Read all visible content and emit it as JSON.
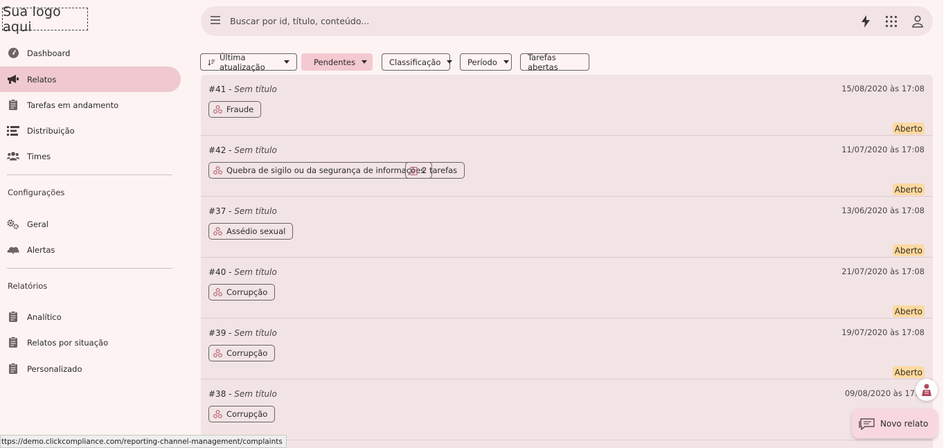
{
  "logo": {
    "text": "Sua logo aqui"
  },
  "sidebar": {
    "items": [
      {
        "label": "Dashboard",
        "icon": "dashboard-icon"
      },
      {
        "label": "Relatos",
        "icon": "megaphone-icon",
        "active": true
      },
      {
        "label": "Tarefas em andamento",
        "icon": "clipboard-icon"
      },
      {
        "label": "Distribuição",
        "icon": "distribution-icon"
      },
      {
        "label": "Times",
        "icon": "team-icon"
      }
    ],
    "config_heading": "Configurações",
    "config_items": [
      {
        "label": "Geral",
        "icon": "gears-icon"
      },
      {
        "label": "Alertas",
        "icon": "alerts-icon"
      }
    ],
    "reports_heading": "Relatórios",
    "report_items": [
      {
        "label": "Analítico",
        "icon": "clipboard-icon"
      },
      {
        "label": "Relatos por situação",
        "icon": "clipboard-icon"
      },
      {
        "label": "Personalizado",
        "icon": "clipboard-icon"
      }
    ]
  },
  "search": {
    "placeholder": "Buscar por id, título, conteúdo..."
  },
  "filters": {
    "sort": "Última atualização",
    "pending": "Pendentes",
    "classification": "Classificação",
    "period": "Período",
    "open_tasks": "Tarefas abertas"
  },
  "reports": [
    {
      "id": "#41",
      "title": "Sem título",
      "date": "15/08/2020 às 17:08",
      "tags": [
        "Fraude"
      ],
      "tasks": "",
      "status": "Aberto"
    },
    {
      "id": "#42",
      "title": "Sem título",
      "date": "11/07/2020 às 17:08",
      "tags": [
        "Quebra de sigilo ou da segurança de informações"
      ],
      "tasks": "2 tarefas",
      "status": "Aberto"
    },
    {
      "id": "#37",
      "title": "Sem título",
      "date": "13/06/2020 às 17:08",
      "tags": [
        "Assédio sexual"
      ],
      "tasks": "",
      "status": "Aberto"
    },
    {
      "id": "#40",
      "title": "Sem título",
      "date": "21/07/2020 às 17:08",
      "tags": [
        "Corrupção"
      ],
      "tasks": "",
      "status": "Aberto"
    },
    {
      "id": "#39",
      "title": "Sem título",
      "date": "19/07/2020 às 17:08",
      "tags": [
        "Corrupção"
      ],
      "tasks": "",
      "status": "Aberto"
    },
    {
      "id": "#38",
      "title": "Sem título",
      "date": "09/08/2020 às 17:",
      "tags": [
        "Corrupção"
      ],
      "tasks": "",
      "status": ""
    }
  ],
  "title_separator": " - ",
  "fab": {
    "label": "Novo relato"
  },
  "statusbar": {
    "url": "ttps://demo.clickcompliance.com/reporting-channel-management/complaints"
  },
  "colors": {
    "active_nav": "#efc9cf",
    "status_badge": "#fcd9a0",
    "background": "#fdf3f3",
    "panel": "#f2e4e5"
  }
}
